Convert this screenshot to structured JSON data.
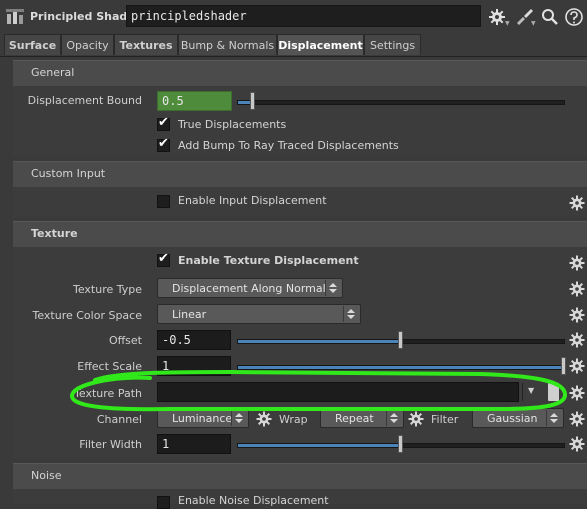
{
  "header": {
    "node_type": "Principled Shader",
    "node_name": "principledshader",
    "icons": [
      "node-type-icon",
      "gear-icon",
      "brush-icon",
      "search-icon",
      "help-icon"
    ]
  },
  "tabs": [
    {
      "label": "Surface",
      "bold": true
    },
    {
      "label": "Opacity"
    },
    {
      "label": "Textures",
      "bold": true
    },
    {
      "label": "Bump & Normals"
    },
    {
      "label": "Displacement",
      "active": true
    },
    {
      "label": "Settings"
    }
  ],
  "general": {
    "title": "General",
    "displacement_bound": {
      "label": "Displacement Bound",
      "value": "0.5",
      "slider_fraction": 0.06
    },
    "true_displacements": {
      "label": "True Displacements",
      "checked": true
    },
    "add_bump": {
      "label": "Add Bump To Ray Traced Displacements",
      "checked": true
    }
  },
  "custom_input": {
    "title": "Custom Input",
    "enable_input": {
      "label": "Enable Input Displacement",
      "checked": false
    }
  },
  "texture": {
    "title": "Texture",
    "enable_texture": {
      "label": "Enable Texture Displacement",
      "checked": true
    },
    "texture_type": {
      "label": "Texture Type",
      "value": "Displacement Along Normal"
    },
    "texture_color_space": {
      "label": "Texture Color Space",
      "value": "Linear"
    },
    "offset": {
      "label": "Offset",
      "value": "-0.5",
      "slider_fraction": 0.5
    },
    "effect_scale": {
      "label": "Effect Scale",
      "value": "1",
      "slider_fraction": 1.0
    },
    "texture_path": {
      "label": "Texture Path",
      "value": ""
    },
    "channel": {
      "label": "Channel",
      "value": "Luminance"
    },
    "wrap": {
      "label": "Wrap",
      "value": "Repeat"
    },
    "filter": {
      "label": "Filter",
      "value": "Gaussian"
    },
    "filter_width": {
      "label": "Filter Width",
      "value": "1",
      "slider_fraction": 0.5
    }
  },
  "noise": {
    "title": "Noise",
    "enable_noise": {
      "label": "Enable Noise Displacement",
      "checked": false
    }
  },
  "colors": {
    "accent_slider": "#4a84b8",
    "field_green": "#4e8c3c",
    "annotation_green": "#31e81a"
  }
}
